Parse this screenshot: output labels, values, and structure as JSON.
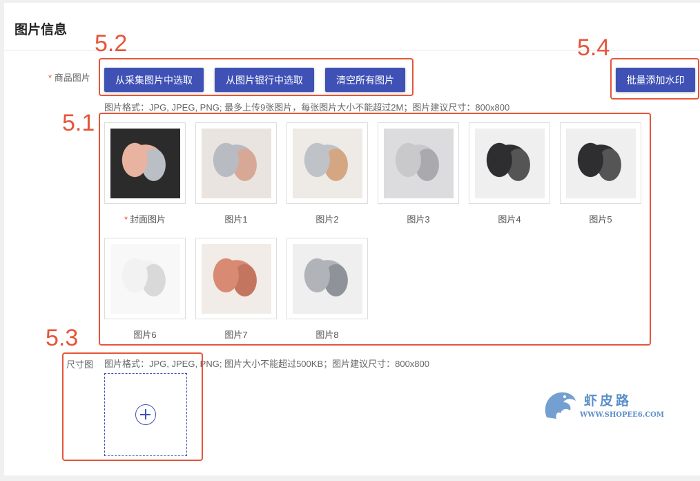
{
  "page_title": "图片信息",
  "fields": {
    "required_mark": "*",
    "product_images_label": "商品图片",
    "size_chart_label": "尺寸图"
  },
  "buttons": {
    "select_from_collected": "从采集图片中选取",
    "select_from_bank": "从图片银行中选取",
    "clear_all": "清空所有图片",
    "batch_watermark": "批量添加水印"
  },
  "hints": {
    "product_images": "图片格式：JPG, JPEG, PNG; 最多上传9张图片，每张图片大小不能超过2M；图片建议尺寸：800x800",
    "size_chart": "图片格式：JPG, JPEG, PNG; 图片大小不能超过500KB；图片建议尺寸：800x800"
  },
  "images": [
    {
      "caption": "封面图片",
      "required": true,
      "colors": [
        "#e9b3a2",
        "#b9bfc4",
        "#2b2b2b"
      ]
    },
    {
      "caption": "图片1",
      "required": false,
      "colors": [
        "#b8bcc2",
        "#d8a896",
        "#e9e4df"
      ]
    },
    {
      "caption": "图片2",
      "required": false,
      "colors": [
        "#bfc2c6",
        "#d4a782",
        "#eeeae6"
      ]
    },
    {
      "caption": "图片3",
      "required": false,
      "colors": [
        "#c9c9cc",
        "#a9a9ae",
        "#dcdcdf"
      ]
    },
    {
      "caption": "图片4",
      "required": false,
      "colors": [
        "#2e2e30",
        "#555",
        "#efefef"
      ]
    },
    {
      "caption": "图片5",
      "required": false,
      "colors": [
        "#2e2e30",
        "#555",
        "#efefef"
      ]
    },
    {
      "caption": "图片6",
      "required": false,
      "colors": [
        "#f2f2f2",
        "#d9d9d9",
        "#f8f8f8"
      ]
    },
    {
      "caption": "图片7",
      "required": false,
      "colors": [
        "#d98a72",
        "#c47560",
        "#f1ece8"
      ]
    },
    {
      "caption": "图片8",
      "required": false,
      "colors": [
        "#b0b3b8",
        "#8f9399",
        "#efefef"
      ]
    }
  ],
  "annotations": [
    "5.1",
    "5.2",
    "5.3",
    "5.4"
  ],
  "watermark": {
    "name": "虾皮路",
    "url": "WWW.SHOPEE6.COM"
  },
  "accent_color": "#3f51b5",
  "annotation_color": "#e5553a"
}
